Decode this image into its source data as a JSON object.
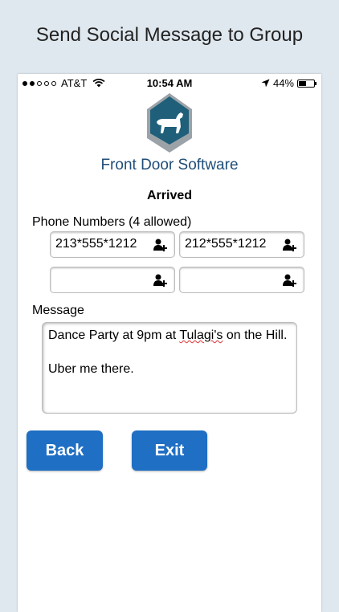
{
  "caption": "Send Social Message to Group",
  "status_bar": {
    "carrier": "AT&T",
    "time": "10:54 AM",
    "battery": "44%"
  },
  "logo": {
    "text": "Front Door Software",
    "icon": "dog-house-logo"
  },
  "screen_title": "Arrived",
  "phone_numbers": {
    "label": "Phone Numbers (4 allowed)",
    "fields": [
      {
        "value": "213*555*1212",
        "icon": "add-contact-icon"
      },
      {
        "value": "212*555*1212",
        "icon": "add-contact-icon"
      },
      {
        "value": "",
        "icon": "add-contact-icon"
      },
      {
        "value": "",
        "icon": "add-contact-icon"
      }
    ]
  },
  "message": {
    "label": "Message",
    "line1_pre": "Dance Party at 9pm at ",
    "line1_spell": "Tulagi's",
    "line1_post": " on the Hill.",
    "line2": "Uber me there."
  },
  "buttons": {
    "back": "Back",
    "exit": "Exit"
  },
  "colors": {
    "button": "#1f6fc4",
    "logo_blue": "#1f5f7a",
    "logo_text": "#1f4e79"
  }
}
